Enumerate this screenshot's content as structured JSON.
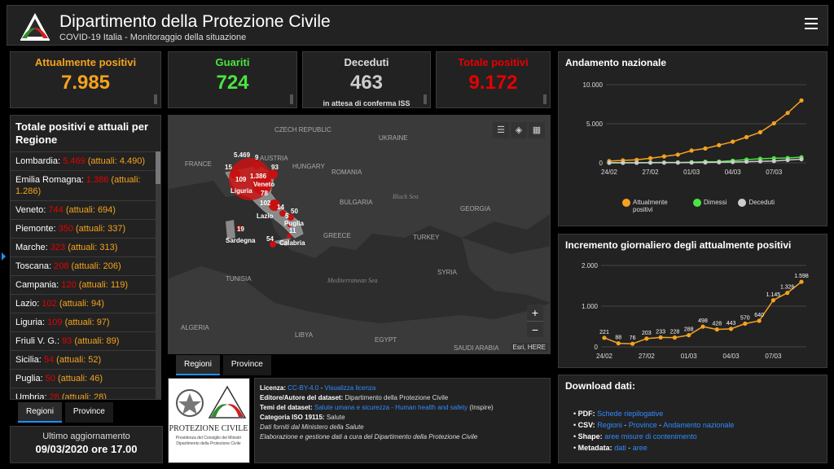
{
  "header": {
    "title": "Dipartimento della Protezione Civile",
    "subtitle": "COVID-19 Italia - Monitoraggio della situazione",
    "menu_icon": "hamburger-menu-icon"
  },
  "stats": {
    "attualmente_positivi": {
      "label": "Attualmente positivi",
      "value": "7.985",
      "color": "#f5a31e"
    },
    "guariti": {
      "label": "Guariti",
      "value": "724",
      "color": "#4ae540"
    },
    "deceduti": {
      "label": "Deceduti",
      "value": "463",
      "note": "in attesa di conferma ISS",
      "color": "#cccccc"
    },
    "totale_positivi": {
      "label": "Totale positivi",
      "value": "9.172",
      "color": "#e60000"
    }
  },
  "regions_panel": {
    "title": "Totale positivi e attuali per Regione",
    "items": [
      {
        "name": "Lombardia:",
        "total": "5.469",
        "current": "(attuali: 4.490)"
      },
      {
        "name": "Emilia Romagna:",
        "total": "1.386",
        "current": "(attuali: 1.286)"
      },
      {
        "name": "Veneto:",
        "total": "744",
        "current": "(attuali: 694)"
      },
      {
        "name": "Piemonte:",
        "total": "350",
        "current": "(attuali: 337)"
      },
      {
        "name": "Marche:",
        "total": "323",
        "current": "(attuali: 313)"
      },
      {
        "name": "Toscana:",
        "total": "208",
        "current": "(attuali: 206)"
      },
      {
        "name": "Campania:",
        "total": "120",
        "current": "(attuali: 119)"
      },
      {
        "name": "Lazio:",
        "total": "102",
        "current": "(attuali: 94)"
      },
      {
        "name": "Liguria:",
        "total": "109",
        "current": "(attuali: 97)"
      },
      {
        "name": "Friuli V. G.:",
        "total": "93",
        "current": "(attuali: 89)"
      },
      {
        "name": "Sicilia:",
        "total": "54",
        "current": "(attuali: 52)"
      },
      {
        "name": "Puglia:",
        "total": "50",
        "current": "(attuali: 46)"
      },
      {
        "name": "Umbria:",
        "total": "28",
        "current": "(attuali: 28)"
      }
    ],
    "tabs": [
      "Regioni",
      "Province"
    ]
  },
  "update": {
    "label": "Ultimo aggiornamento",
    "value": "09/03/2020 ore 17.00"
  },
  "map": {
    "countries": [
      "FRANCE",
      "CZECH REPUBLIC",
      "AUSTRIA",
      "HUNGARY",
      "UKRAINE",
      "ROMANIA",
      "BULGARIA",
      "GREECE",
      "TURKEY",
      "GEORGIA",
      "SYRIA",
      "TUNISIA",
      "LIBYA",
      "ALGERIA",
      "EGYPT",
      "SAUDI ARABIA"
    ],
    "seas": [
      "Black Sea",
      "Mediterranean Sea"
    ],
    "regions": [
      "Veneto",
      "Liguria",
      "Lazio",
      "Puglia",
      "Sardegna",
      "Calabria"
    ],
    "counts": [
      "5.469",
      "9",
      "93",
      "15",
      "109",
      "1.386",
      "78",
      "102",
      "14",
      "50",
      "5",
      "11",
      "19",
      "54"
    ],
    "attribution": "Esri, HERE",
    "zoom_in": "+",
    "zoom_out": "−",
    "tabs": [
      "Regioni",
      "Province"
    ],
    "tool_icons": [
      "list-icon",
      "layers-icon",
      "qr-code-icon"
    ]
  },
  "chart_nazionale": {
    "title": "Andamento nazionale",
    "legend": [
      "Attualmente positivi",
      "Dimessi",
      "Deceduti"
    ]
  },
  "chart_incremento": {
    "title": "Incremento giornaliero degli attualmente positivi"
  },
  "chart_data": [
    {
      "type": "line",
      "title": "Andamento nazionale",
      "x": [
        "24/02",
        "25/02",
        "26/02",
        "27/02",
        "28/02",
        "29/02",
        "01/03",
        "02/03",
        "03/03",
        "04/03",
        "05/03",
        "06/03",
        "07/03",
        "08/03",
        "09/03"
      ],
      "xticks": [
        "24/02",
        "27/02",
        "01/03",
        "04/03",
        "07/03"
      ],
      "yticks": [
        "0",
        "5.000",
        "10.000"
      ],
      "ylim": [
        0,
        10000
      ],
      "series": [
        {
          "name": "Attualmente positivi",
          "color": "#f5a31e",
          "values": [
            221,
            311,
            385,
            588,
            821,
            1049,
            1577,
            1835,
            2263,
            2706,
            3296,
            3916,
            5061,
            6387,
            7985
          ]
        },
        {
          "name": "Dimessi",
          "color": "#4ae540",
          "values": [
            1,
            1,
            3,
            45,
            46,
            50,
            83,
            149,
            160,
            276,
            414,
            523,
            589,
            622,
            724
          ]
        },
        {
          "name": "Deceduti",
          "color": "#cccccc",
          "values": [
            7,
            10,
            12,
            17,
            21,
            29,
            34,
            52,
            79,
            107,
            148,
            197,
            233,
            366,
            463
          ]
        }
      ]
    },
    {
      "type": "line",
      "title": "Incremento giornaliero degli attualmente positivi",
      "x": [
        "24/02",
        "25/02",
        "26/02",
        "27/02",
        "28/02",
        "29/02",
        "01/03",
        "02/03",
        "03/03",
        "04/03",
        "05/03",
        "06/03",
        "07/03",
        "08/03",
        "09/03"
      ],
      "xticks": [
        "24/02",
        "27/02",
        "01/03",
        "04/03",
        "07/03"
      ],
      "yticks": [
        "0",
        "1.000",
        "2.000"
      ],
      "ylim": [
        0,
        2000
      ],
      "series": [
        {
          "color": "#f5a31e",
          "values": [
            221,
            88,
            76,
            203,
            233,
            228,
            288,
            498,
            428,
            443,
            570,
            640,
            1145,
            1326,
            1598
          ],
          "labels": [
            "221",
            "88",
            "76",
            "203",
            "233",
            "228",
            "288",
            "498",
            "428",
            "443",
            "570",
            "640",
            "1.145",
            "1.326",
            "1.598"
          ]
        }
      ]
    }
  ],
  "info": {
    "logo_text": "PROTEZIONE CIVILE",
    "logo_sub1": "Presidenza del Consiglio dei Ministri",
    "logo_sub2": "Dipartimento della Protezione Civile",
    "licenza_label": "Licenza:",
    "licenza_link": "CC-BY-4.0",
    "licenza_sep": "-",
    "licenza_link2": "Visualizza licenza",
    "editore_label": "Editore/Autore del dataset:",
    "editore_value": "Dipartimento della Protezione Civile",
    "temi_label": "Temi del dataset:",
    "temi_link": "Salute umana e sicurezza - Human health and safety",
    "temi_suffix": "(Inspire)",
    "categoria_label": "Categoria ISO 19115:",
    "categoria_value": "Salute",
    "line5": "Dati forniti dal Ministero della Salute",
    "line6": "Elaborazione e gestione dati a cura del Dipartimento della Protezione Civile"
  },
  "download": {
    "title": "Download dati:",
    "pdf_label": "PDF:",
    "pdf_link": "Schede riepilogative",
    "csv_label": "CSV:",
    "csv_link1": "Regioni",
    "csv_link2": "Province",
    "csv_link3": "Andamento nazionale",
    "shape_label": "Shape:",
    "shape_link": "aree misure di contenimento",
    "meta_label": "Metadata:",
    "meta_link1": "dati",
    "meta_link2": "aree",
    "sep": "-"
  }
}
